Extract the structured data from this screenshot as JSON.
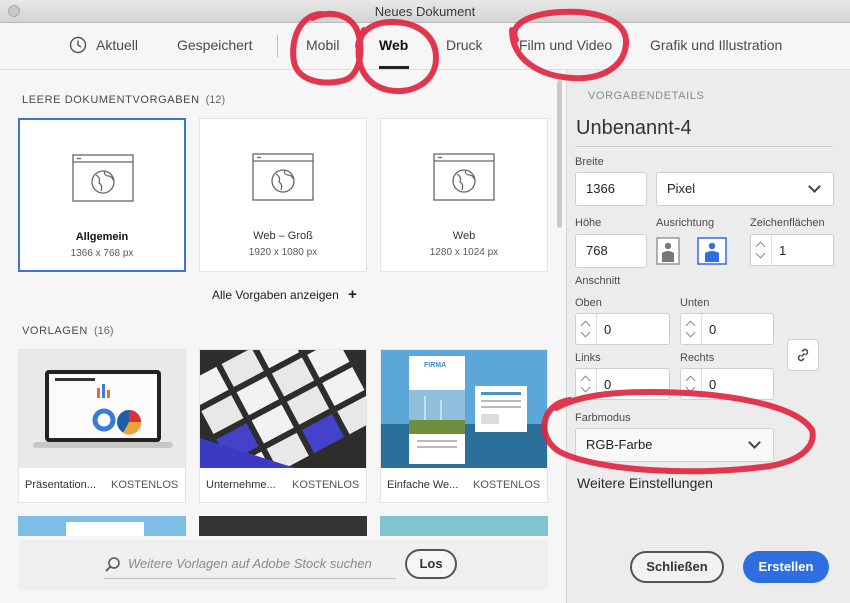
{
  "window": {
    "title": "Neues Dokument"
  },
  "tabs": [
    {
      "label": "Aktuell"
    },
    {
      "label": "Gespeichert"
    },
    {
      "label": "Mobil"
    },
    {
      "label": "Web"
    },
    {
      "label": "Druck"
    },
    {
      "label": "Film und Video"
    },
    {
      "label": "Grafik und Illustration"
    }
  ],
  "presets": {
    "title": "LEERE DOKUMENTVORGABEN",
    "count": "(12)",
    "items": [
      {
        "name": "Allgemein",
        "size": "1366 x 768 px"
      },
      {
        "name": "Web – Groß",
        "size": "1920 x 1080 px"
      },
      {
        "name": "Web",
        "size": "1280 x 1024 px"
      }
    ],
    "show_all": "Alle Vorgaben anzeigen",
    "show_all_icon": "+"
  },
  "templates": {
    "title": "VORLAGEN",
    "count": "(16)",
    "items": [
      {
        "name": "Präsentation...",
        "badge": "KOSTENLOS"
      },
      {
        "name": "Unternehme...",
        "badge": "KOSTENLOS"
      },
      {
        "name": "Einfache We...",
        "badge": "KOSTENLOS"
      }
    ],
    "thumb3_title": "FIRMA"
  },
  "search": {
    "placeholder": "Weitere Vorlagen auf Adobe Stock suchen",
    "button": "Los"
  },
  "details": {
    "section": "VORGABENDETAILS",
    "doc_name": "Unbenannt-4",
    "width_label": "Breite",
    "width": "1366",
    "unit": "Pixel",
    "height_label": "Höhe",
    "height": "768",
    "orientation_label": "Ausrichtung",
    "artboards_label": "Zeichenflächen",
    "artboards": "1",
    "bleed_label": "Anschnitt",
    "top_label": "Oben",
    "top": "0",
    "bottom_label": "Unten",
    "bottom": "0",
    "left_label": "Links",
    "left": "0",
    "right_label": "Rechts",
    "right": "0",
    "colormode_label": "Farbmodus",
    "colormode": "RGB-Farbe",
    "more_settings": "Weitere Einstellungen"
  },
  "buttons": {
    "close": "Schließen",
    "create": "Erstellen"
  },
  "colors": {
    "accent": "#2e6ee0",
    "marker": "#e0263f"
  }
}
